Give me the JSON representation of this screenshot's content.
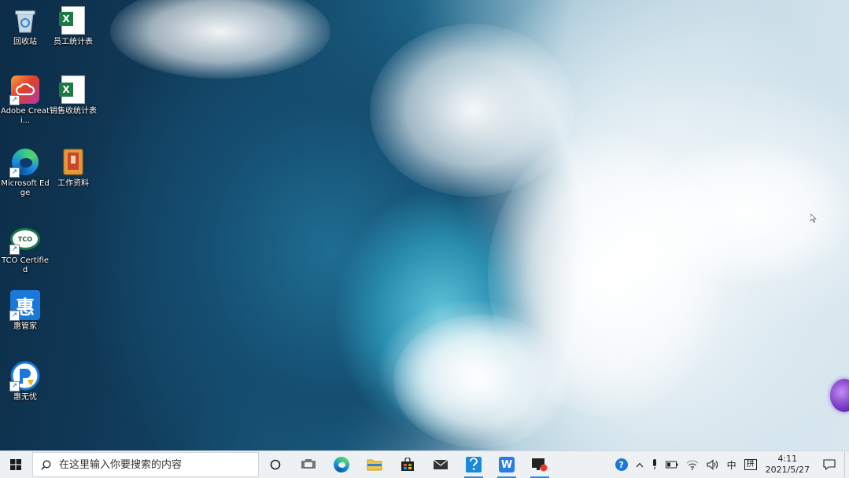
{
  "desktop": {
    "icons": [
      {
        "label": "回收站"
      },
      {
        "label": "员工统计表"
      },
      {
        "label": "Adobe Creati..."
      },
      {
        "label": "销售收统计表"
      },
      {
        "label": "Microsoft Edge"
      },
      {
        "label": "工作资料"
      },
      {
        "label": "TCO Certified"
      },
      {
        "label": "惠管家"
      },
      {
        "label": "惠无忧"
      }
    ],
    "glyphs": {
      "excel": "X",
      "tco": "TCO",
      "huiguanjia": "惠",
      "shortcut": "↗"
    }
  },
  "taskbar": {
    "search_placeholder": "在这里输入你要搜索的内容",
    "apps": [
      "cortana",
      "task-view",
      "edge",
      "file-explorer",
      "store",
      "mail",
      "app-blue",
      "wps",
      "screen-recorder"
    ],
    "wps_glyph": "W",
    "tray": {
      "help_glyph": "?",
      "chevron": "^",
      "ime_lang": "中",
      "ime_mode": "拼"
    },
    "clock": {
      "time": "4:11",
      "date": "2021/5/27"
    }
  },
  "colors": {
    "accent": "#3b86d6",
    "taskbar_bg": "#eef1f4",
    "excel_green": "#1d7a45",
    "edge_blue": "#1c8ce0",
    "adobe_red": "#e0402d",
    "wps_blue": "#2a7ce0"
  }
}
